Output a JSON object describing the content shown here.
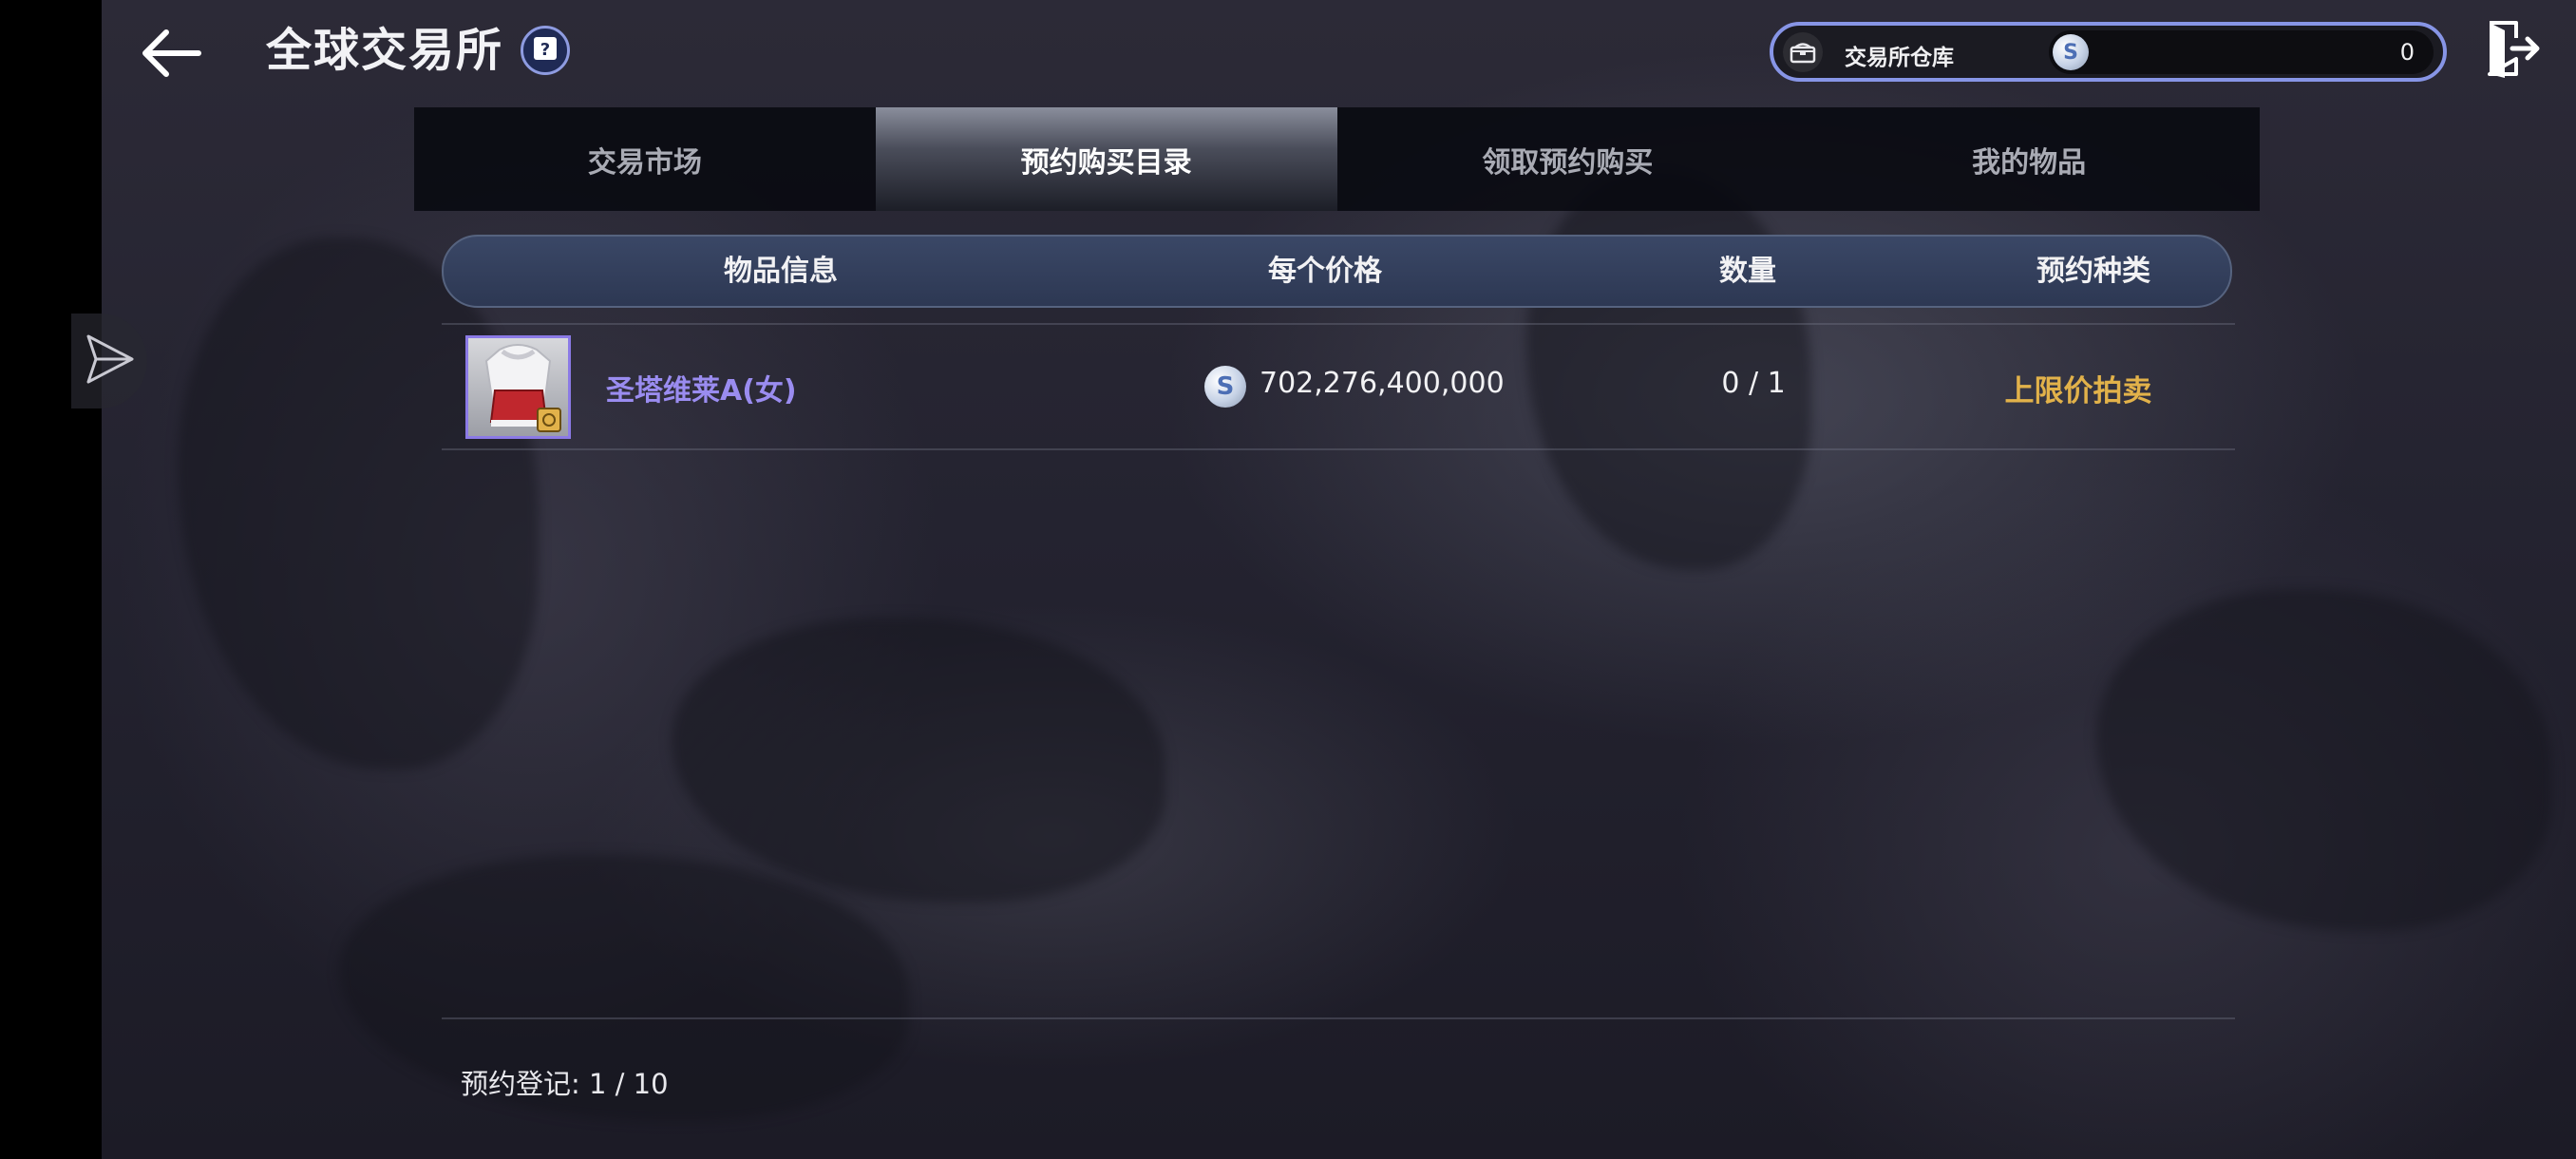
{
  "header": {
    "title": "全球交易所"
  },
  "warehouse": {
    "label": "交易所仓库",
    "amount": "0",
    "coin_symbol": "S"
  },
  "tabs": [
    {
      "label": "交易市场",
      "active": false
    },
    {
      "label": "预约购买目录",
      "active": true
    },
    {
      "label": "领取预约购买",
      "active": false
    },
    {
      "label": "我的物品",
      "active": false
    }
  ],
  "table": {
    "headers": [
      "物品信息",
      "每个价格",
      "数量",
      "预约种类"
    ],
    "rows": [
      {
        "name": "圣塔维莱A(女)",
        "price": "702,276,400,000",
        "quantity": "0 / 1",
        "reservation_type": "上限价拍卖",
        "coin_symbol": "S"
      }
    ]
  },
  "footer": {
    "text": "预约登记: 1 / 10"
  },
  "colors": {
    "accent": "#8795e6",
    "item_name": "#9a8cf0",
    "reservation_type": "#e2b24a"
  }
}
